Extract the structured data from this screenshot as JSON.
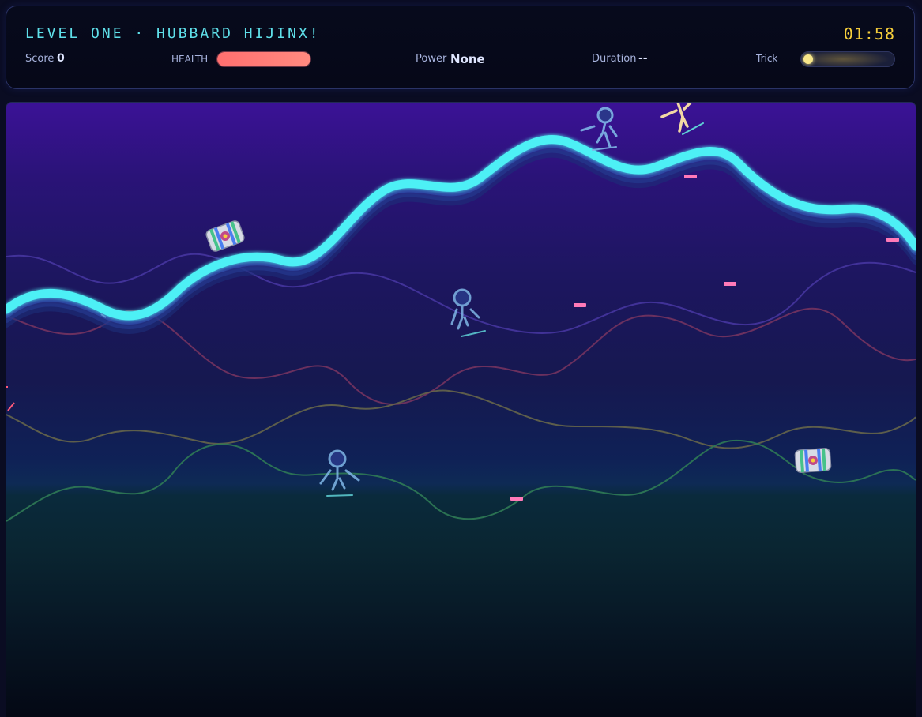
{
  "hud": {
    "level_title": "LEVEL ONE · HUBBARD HIJINX!",
    "timer": "01:58",
    "score_label": "Score",
    "score_value": "0",
    "health_label": "HEALTH",
    "health_level": 1.0,
    "power_label": "Power",
    "power_value": "None",
    "duration_label": "Duration",
    "duration_value": "--",
    "trick_label": "Trick",
    "trick_level": 0.05
  },
  "colors": {
    "accent_cyan": "#5fe0ea",
    "timer_yellow": "#f7cf3b",
    "health_red": "#ff7070",
    "track_main": "#4ef0f5",
    "pickup_pink": "#ff7ab8"
  },
  "game": {
    "sprites": [
      {
        "kind": "skier",
        "color": "#7fb6e6"
      },
      {
        "kind": "skier",
        "color": "#f3d9a4"
      },
      {
        "kind": "skier",
        "color": "#7fb6e6"
      },
      {
        "kind": "skier",
        "color": "#7fb6e6"
      }
    ],
    "pickups": [
      "barrel-powerup-icon",
      "barrel-powerup-icon"
    ]
  }
}
